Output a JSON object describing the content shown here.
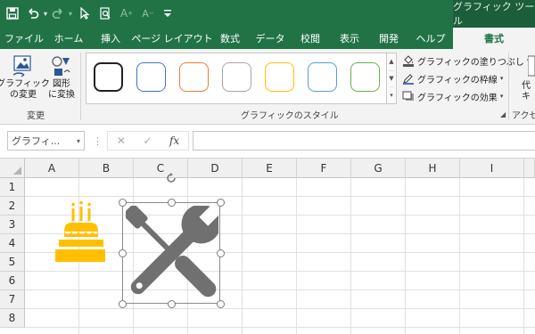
{
  "quick_access": {
    "save_icon": "save-icon",
    "undo_icon": "undo-icon",
    "redo_icon": "redo-icon",
    "select_icon": "pointer-icon",
    "print_preview_icon": "print-preview-icon",
    "font_grow_icon": "font-grow-icon",
    "font_shrink_icon": "font-shrink-icon",
    "customize_icon": "customize-qat-icon"
  },
  "context_tool_title": "グラフィック ツール",
  "tabs": [
    {
      "label": "ファイル"
    },
    {
      "label": "ホーム"
    },
    {
      "label": "挿入"
    },
    {
      "label": "ページ レイアウト"
    },
    {
      "label": "数式"
    },
    {
      "label": "データ"
    },
    {
      "label": "校閲"
    },
    {
      "label": "表示"
    },
    {
      "label": "開発"
    },
    {
      "label": "ヘルプ"
    },
    {
      "label": "書式",
      "active": true
    }
  ],
  "ribbon": {
    "change_group": {
      "change_graphic": "グラフィック\nの変更",
      "convert_shape": "図形\nに変換",
      "label": "変更"
    },
    "styles_group": {
      "label": "グラフィックのスタイル",
      "swatches": [
        {
          "color": "#222222"
        },
        {
          "color": "#4472c4"
        },
        {
          "color": "#ed7d31"
        },
        {
          "color": "#a5a5a5"
        },
        {
          "color": "#ffc000"
        },
        {
          "color": "#5b9bd5"
        },
        {
          "color": "#70ad47"
        }
      ],
      "fill": "グラフィックの塗りつぶし",
      "outline": "グラフィックの枠線",
      "effects": "グラフィックの効果"
    },
    "accessibility_group": {
      "label": "アクセシ",
      "alt_text_partial": "代",
      "alt_text_partial2": "キ"
    }
  },
  "formula_bar": {
    "name_box": "グラフィ...",
    "cancel": "✕",
    "enter": "✓",
    "fx": "fx",
    "value": ""
  },
  "grid": {
    "columns": [
      "A",
      "B",
      "C",
      "D",
      "E",
      "F",
      "G",
      "H",
      "I"
    ],
    "rows": [
      "1",
      "2",
      "3",
      "4",
      "5",
      "6",
      "7",
      "8"
    ]
  },
  "colors": {
    "excel_green": "#217346",
    "cake_icon": "#ffc000",
    "tools_icon": "#707070"
  },
  "graphics": [
    {
      "name": "birthday-cake-icon"
    },
    {
      "name": "wrench-screwdriver-icon",
      "selected": true
    }
  ]
}
